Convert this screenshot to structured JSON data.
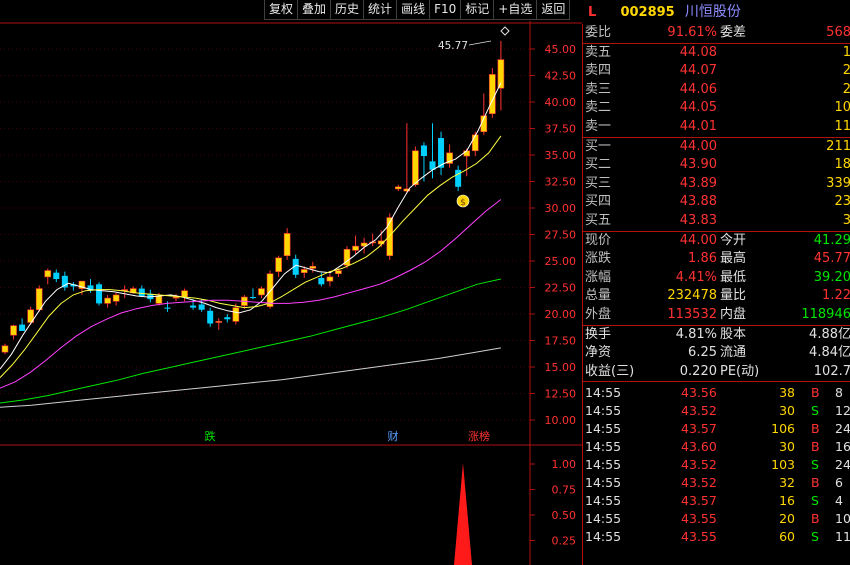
{
  "toolbar": [
    "复权",
    "叠加",
    "历史",
    "统计",
    "画线",
    "F10",
    "标记",
    "+自选",
    "返回"
  ],
  "stock": {
    "flag": "L",
    "code": "002895",
    "name": "川恒股份"
  },
  "chart": {
    "price_ticks": [
      "45.00",
      "42.50",
      "40.00",
      "37.50",
      "35.00",
      "32.50",
      "30.00",
      "27.50",
      "25.00",
      "22.50",
      "20.00",
      "17.50",
      "15.00",
      "12.50",
      "10.00"
    ],
    "high_label": "45.77",
    "markers": [
      {
        "text": "跌",
        "color": "#00e600"
      },
      {
        "text": "财",
        "color": "#5aa0ff"
      },
      {
        "text": "涨榜",
        "color": "#ff3232"
      }
    ],
    "volume_ticks": [
      "1.00",
      "0.75",
      "0.50",
      "0.25"
    ],
    "colors": {
      "up": "#ff3232",
      "up_bar": "#ffd700",
      "down": "#00d0ff",
      "ma5": "#ffffff",
      "ma10": "#ffff40",
      "ma20": "#ff40ff",
      "ma60": "#00e600",
      "ma120": "#d0d0d0"
    }
  },
  "quote": {
    "weibi": {
      "label": "委比",
      "value": "91.61%",
      "label2": "委差",
      "value2": "568"
    },
    "sells": [
      {
        "label": "卖五",
        "price": "44.08",
        "vol": "1"
      },
      {
        "label": "卖四",
        "price": "44.07",
        "vol": "2"
      },
      {
        "label": "卖三",
        "price": "44.06",
        "vol": "2"
      },
      {
        "label": "卖二",
        "price": "44.05",
        "vol": "10"
      },
      {
        "label": "卖一",
        "price": "44.01",
        "vol": "11"
      }
    ],
    "buys": [
      {
        "label": "买一",
        "price": "44.00",
        "vol": "211"
      },
      {
        "label": "买二",
        "price": "43.90",
        "vol": "18"
      },
      {
        "label": "买三",
        "price": "43.89",
        "vol": "339"
      },
      {
        "label": "买四",
        "price": "43.88",
        "vol": "23"
      },
      {
        "label": "买五",
        "price": "43.83",
        "vol": "3"
      }
    ],
    "stats1": [
      {
        "l1": "现价",
        "v1": "44.00",
        "c1": "red",
        "l2": "今开",
        "v2": "41.29",
        "c2": "green"
      },
      {
        "l1": "涨跌",
        "v1": "1.86",
        "c1": "red",
        "l2": "最高",
        "v2": "45.77",
        "c2": "red"
      },
      {
        "l1": "涨幅",
        "v1": "4.41%",
        "c1": "red",
        "l2": "最低",
        "v2": "39.20",
        "c2": "green"
      },
      {
        "l1": "总量",
        "v1": "232478",
        "c1": "yellow",
        "l2": "量比",
        "v2": "1.22",
        "c2": "red"
      },
      {
        "l1": "外盘",
        "v1": "113532",
        "c1": "red",
        "l2": "内盘",
        "v2": "118946",
        "c2": "green"
      }
    ],
    "stats2": [
      {
        "l1": "换手",
        "v1": "4.81%",
        "l2": "股本",
        "v2": "4.88亿"
      },
      {
        "l1": "净资",
        "v1": "6.25",
        "l2": "流通",
        "v2": "4.84亿"
      },
      {
        "l1": "收益(三)",
        "v1": "0.220",
        "l2": "PE(动)",
        "v2": "102.7"
      }
    ],
    "ticks": [
      {
        "time": "14:55",
        "price": "43.56",
        "vol": "38",
        "bs": "B",
        "n": "8"
      },
      {
        "time": "14:55",
        "price": "43.52",
        "vol": "30",
        "bs": "S",
        "n": "12"
      },
      {
        "time": "14:55",
        "price": "43.57",
        "vol": "106",
        "bs": "B",
        "n": "24"
      },
      {
        "time": "14:55",
        "price": "43.60",
        "vol": "30",
        "bs": "B",
        "n": "16"
      },
      {
        "time": "14:55",
        "price": "43.52",
        "vol": "103",
        "bs": "S",
        "n": "24"
      },
      {
        "time": "14:55",
        "price": "43.52",
        "vol": "32",
        "bs": "B",
        "n": "6"
      },
      {
        "time": "14:55",
        "price": "43.57",
        "vol": "16",
        "bs": "S",
        "n": "4"
      },
      {
        "time": "14:55",
        "price": "43.55",
        "vol": "20",
        "bs": "B",
        "n": "10"
      },
      {
        "time": "14:55",
        "price": "43.55",
        "vol": "60",
        "bs": "S",
        "n": "11"
      }
    ]
  }
}
